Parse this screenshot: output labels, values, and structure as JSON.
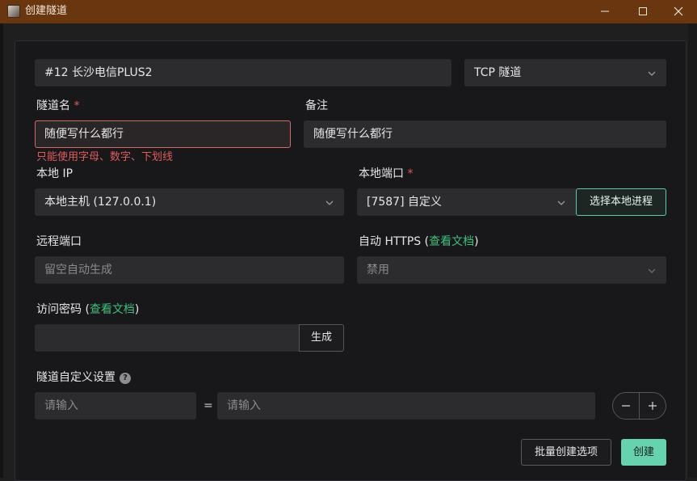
{
  "window": {
    "title": "创建隧道",
    "minimize_icon": "minimize-icon",
    "maximize_icon": "maximize-icon",
    "close_icon": "close-icon"
  },
  "node_select": {
    "value": "#12 长沙电信PLUS2"
  },
  "type_select": {
    "value": "TCP 隧道"
  },
  "tunnel_name": {
    "label": "隧道名",
    "required_mark": "*",
    "value": "随便写什么都行",
    "error": "只能使用字母、数字、下划线"
  },
  "remark": {
    "label": "备注",
    "value": "随便写什么都行"
  },
  "local_ip": {
    "label": "本地 IP",
    "value": "本地主机 (127.0.0.1)"
  },
  "local_port": {
    "label": "本地端口",
    "required_mark": "*",
    "value": "[7587] 自定义",
    "select_process_label": "选择本地进程"
  },
  "remote_port": {
    "label": "远程端口",
    "placeholder": "留空自动生成"
  },
  "auto_https": {
    "label_prefix": "自动 HTTPS (",
    "doc_link": "查看文档",
    "label_suffix": ")",
    "value": "禁用"
  },
  "access_password": {
    "label_prefix": "访问密码 (",
    "doc_link": "查看文档",
    "label_suffix": ")",
    "value": "",
    "generate_label": "生成"
  },
  "custom_settings": {
    "label": "隧道自定义设置",
    "help_icon": "question-circle-icon",
    "help_glyph": "?",
    "key_placeholder": "请输入",
    "equals": "=",
    "value_placeholder": "请输入"
  },
  "footer": {
    "batch_label": "批量创建选项",
    "create_label": "创建"
  },
  "colors": {
    "accent": "#67d3ae",
    "error": "#e05b5b",
    "titlebar": "#6a360f"
  }
}
